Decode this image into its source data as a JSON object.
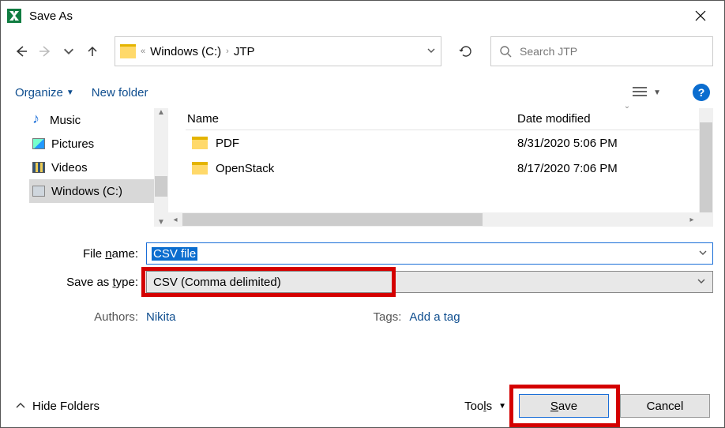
{
  "title": "Save As",
  "breadcrumb": {
    "drive": "Windows (C:)",
    "folder": "JTP"
  },
  "search_placeholder": "Search JTP",
  "toolbar": {
    "organize": "Organize",
    "newfolder": "New folder"
  },
  "sidebar": {
    "items": [
      {
        "label": "Music"
      },
      {
        "label": "Pictures"
      },
      {
        "label": "Videos"
      },
      {
        "label": "Windows (C:)"
      }
    ]
  },
  "columns": {
    "name": "Name",
    "date": "Date modified"
  },
  "files": [
    {
      "name": "PDF",
      "date": "8/31/2020 5:06 PM"
    },
    {
      "name": "OpenStack",
      "date": "8/17/2020 7:06 PM"
    }
  ],
  "form": {
    "filename_label_pre": "File ",
    "filename_label_u": "n",
    "filename_label_post": "ame:",
    "filename_value": "CSV file",
    "type_label_pre": "Save as ",
    "type_label_u": "t",
    "type_label_post": "ype:",
    "type_value": "CSV (Comma delimited)",
    "authors_label": "Authors:",
    "authors_value": "Nikita",
    "tags_label": "Tags:",
    "tags_value": "Add a tag"
  },
  "bottom": {
    "hide": "Hide Folders",
    "tools_pre": "Too",
    "tools_u": "l",
    "tools_post": "s",
    "save_u": "S",
    "save_post": "ave",
    "cancel": "Cancel"
  }
}
